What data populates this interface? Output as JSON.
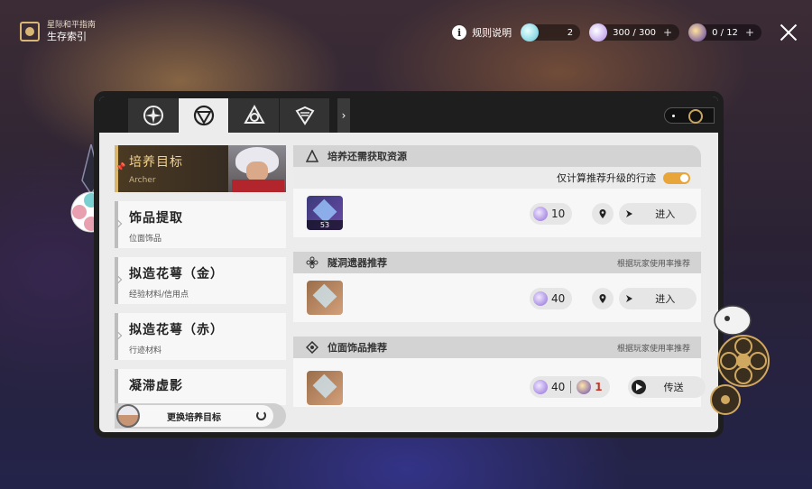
{
  "header": {
    "title_small": "星际和平指南",
    "title_big": "生存索引",
    "rules_label": "规则说明",
    "resources": [
      {
        "name": "resource-1",
        "value": "2",
        "has_plus": false,
        "color": "#7fe0e8"
      },
      {
        "name": "resource-2",
        "value": "300 / 300",
        "has_plus": true,
        "color": "#c8a8ff"
      },
      {
        "name": "resource-3",
        "value": "0 / 12",
        "has_plus": true,
        "color": "#8a6ad8"
      }
    ],
    "plus": "+"
  },
  "tabs": [
    {
      "icon": "compass-icon",
      "active": false
    },
    {
      "icon": "target-icon",
      "active": true
    },
    {
      "icon": "triangle-emblem-icon",
      "active": false
    },
    {
      "icon": "crest-icon",
      "active": false
    }
  ],
  "tab_arrow": "›",
  "sidebar": {
    "target": {
      "title": "培养目标",
      "subtitle": "Archer"
    },
    "items": [
      {
        "title": "饰品提取",
        "subtitle": "位面饰品"
      },
      {
        "title": "拟造花萼（金）",
        "subtitle": "经验材料/信用点"
      },
      {
        "title": "拟造花萼（赤）",
        "subtitle": "行迹材料"
      },
      {
        "title": "凝滞虚影",
        "subtitle": ""
      }
    ],
    "change_label": "更换培养目标"
  },
  "main": {
    "section1": {
      "title": "培养还需获取资源",
      "toggle_label": "仅计算推荐升级的行迹",
      "toggle_on": true,
      "row": {
        "item_count": "53",
        "cost": "10",
        "action": "进入"
      }
    },
    "section2": {
      "title": "隧洞遗器推荐",
      "note": "根据玩家使用率推荐",
      "row": {
        "cost": "40",
        "action": "进入"
      }
    },
    "section3": {
      "title": "位面饰品推荐",
      "note": "根据玩家使用率推荐",
      "row": {
        "cost": "40",
        "cost2": "1",
        "action": "传送"
      }
    }
  },
  "colors": {
    "accent": "#e8a63a",
    "gold": "#d9b66b",
    "panel": "#ececec"
  }
}
